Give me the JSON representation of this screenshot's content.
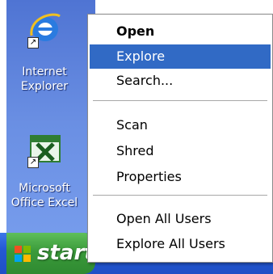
{
  "desktop": {
    "icons": [
      {
        "name": "internet-explorer",
        "label_line1": "Internet",
        "label_line2": "Explorer"
      },
      {
        "name": "microsoft-office-excel",
        "label_line1": "Microsoft",
        "label_line2": "Office Excel"
      }
    ]
  },
  "taskbar": {
    "start_label": "start"
  },
  "context_menu": {
    "items": [
      {
        "label": "Open",
        "bold": true
      },
      {
        "label": "Explore",
        "highlighted": true
      },
      {
        "label": "Search..."
      },
      {
        "label": "Scan"
      },
      {
        "label": "Shred"
      },
      {
        "label": "Properties"
      },
      {
        "label": "Open All Users"
      },
      {
        "label": "Explore All Users"
      }
    ]
  },
  "colors": {
    "highlight": "#316ac5",
    "desktop": "#5a7fd9",
    "start_green": "#3a9a3a",
    "taskbar_blue": "#2459d4"
  }
}
